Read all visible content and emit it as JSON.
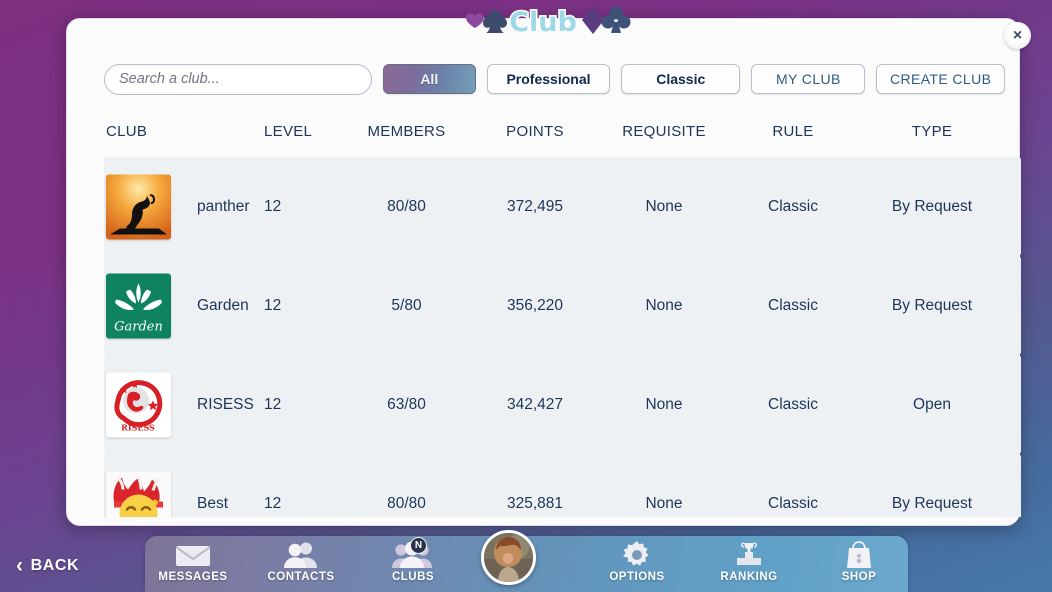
{
  "window": {
    "logo_text": "Club",
    "close_label": "×"
  },
  "toolbar": {
    "search_placeholder": "Search a club...",
    "search_value": "",
    "filters": [
      {
        "label": "All",
        "active": true
      },
      {
        "label": "Professional",
        "active": false
      },
      {
        "label": "Classic",
        "active": false
      }
    ],
    "my_club_label": "MY CLUB",
    "create_club_label": "CREATE CLUB"
  },
  "table": {
    "headers": {
      "club": "CLUB",
      "level": "LEVEL",
      "members": "MEMBERS",
      "points": "POINTS",
      "requisite": "REQUISITE",
      "rule": "RULE",
      "type": "TYPE"
    },
    "rows": [
      {
        "name": "panther",
        "level": "12",
        "members": "80/80",
        "points": "372,495",
        "requisite": "None",
        "rule": "Classic",
        "type": "By Request",
        "logo": "panther-silhouette-sunset"
      },
      {
        "name": "Garden",
        "level": "12",
        "members": "5/80",
        "points": "356,220",
        "requisite": "None",
        "rule": "Classic",
        "type": "By Request",
        "logo": "garden-lotus-green",
        "logo_text": "Garden"
      },
      {
        "name": "RISESS",
        "level": "12",
        "members": "63/80",
        "points": "342,427",
        "requisite": "None",
        "rule": "Classic",
        "type": "Open",
        "logo": "risess-red-globe",
        "logo_text": "RISESS"
      },
      {
        "name": "Best",
        "level": "12",
        "members": "80/80",
        "points": "325,881",
        "requisite": "None",
        "rule": "Classic",
        "type": "By Request",
        "logo": "joker-emoji-red-hat"
      }
    ]
  },
  "back_button": {
    "label": "BACK",
    "chevron": "‹"
  },
  "nav": {
    "items": [
      {
        "label": "MESSAGES",
        "icon": "envelope-icon"
      },
      {
        "label": "CONTACTS",
        "icon": "contacts-icon"
      },
      {
        "label": "CLUBS",
        "icon": "clubs-icon",
        "badge": "N"
      },
      {
        "label": "OPTIONS",
        "icon": "gear-icon"
      },
      {
        "label": "RANKING",
        "icon": "podium-trophy-icon"
      },
      {
        "label": "SHOP",
        "icon": "shopping-bag-icon"
      }
    ],
    "avatar": "user-profile-photo"
  },
  "colors": {
    "bg_purple": "#7d2f80",
    "bg_blue": "#4579aa",
    "panel": "#fbfbfc",
    "row": "#eef1f4",
    "text_navy": "#1e3557",
    "accent_active": "#7d6c9b"
  }
}
